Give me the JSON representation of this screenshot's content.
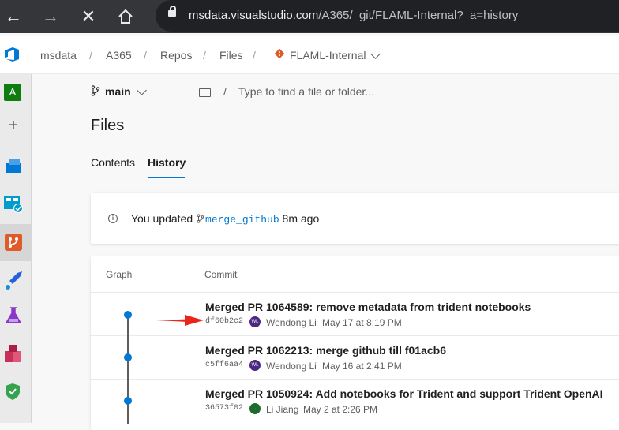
{
  "browser": {
    "url_host": "msdata.visualstudio.com",
    "url_path": "/A365/_git/FLAML-Internal?_a=history"
  },
  "breadcrumbs": [
    "msdata",
    "A365",
    "Repos",
    "Files",
    "FLAML-Internal"
  ],
  "rail": {
    "avatar_letter": "A"
  },
  "branch": {
    "name": "main"
  },
  "path_search": {
    "placeholder": "Type to find a file or folder..."
  },
  "page": {
    "title": "Files"
  },
  "tabs": [
    {
      "label": "Contents",
      "active": false
    },
    {
      "label": "History",
      "active": true
    }
  ],
  "notice": {
    "prefix": "You updated",
    "branch": "merge_github",
    "suffix": "8m ago"
  },
  "table": {
    "columns": [
      "Graph",
      "Commit"
    ],
    "rows": [
      {
        "title": "Merged PR 1064589: remove metadata from trident notebooks",
        "hash": "df60b2c2",
        "initials": "WL",
        "author": "Wendong Li",
        "date": "May 17 at 8:19 PM",
        "avatar_color": "#4b2882"
      },
      {
        "title": "Merged PR 1062213: merge github till f01acb6",
        "hash": "c5ff6aa4",
        "initials": "WL",
        "author": "Wendong Li",
        "date": "May 16 at 2:41 PM",
        "avatar_color": "#4b2882"
      },
      {
        "title": "Merged PR 1050924: Add notebooks for Trident and support Trident OpenAI",
        "hash": "36573f02",
        "initials": "LJ",
        "author": "Li Jiang",
        "date": "May 2 at 2:26 PM",
        "avatar_color": "#1e6b2e"
      }
    ]
  },
  "colors": {
    "accent": "#0078d4",
    "annotation_arrow": "#e8261c"
  }
}
